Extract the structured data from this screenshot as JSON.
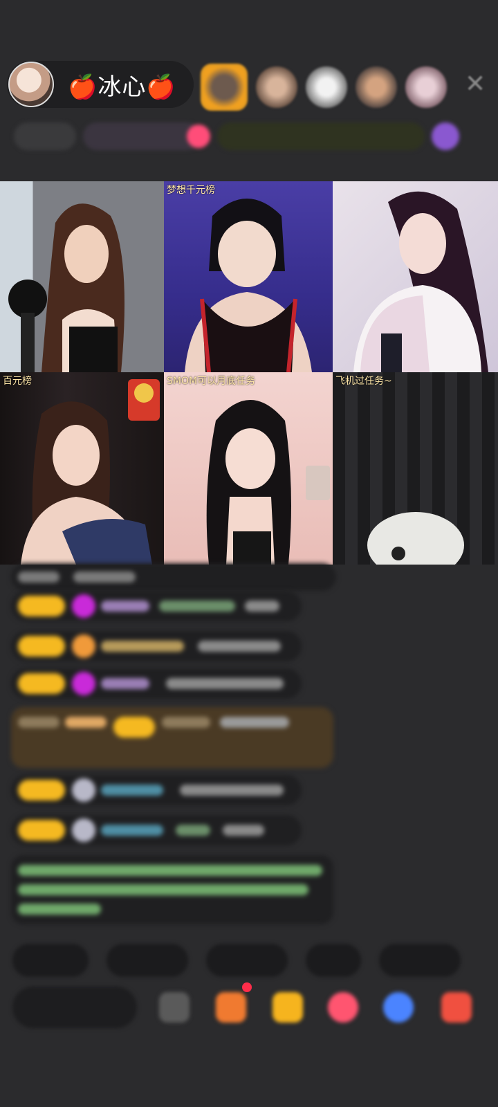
{
  "header": {
    "host_name": "冰心",
    "apple_glyph": "🍎",
    "close_glyph": "✕"
  },
  "colors": {
    "background": "#2b2b2d",
    "badge": "#f5b921",
    "bubble": "#1f1f21"
  },
  "streams": [
    {
      "overlay": ""
    },
    {
      "overlay": "梦想千元榜"
    },
    {
      "overlay": ""
    },
    {
      "overlay": "百元榜"
    },
    {
      "overlay": "SMOM可以月底任务"
    },
    {
      "overlay": "飞机过任务~"
    }
  ],
  "icons": [
    "avatar",
    "close-icon",
    "gift-icon",
    "box-icon",
    "gift-bag-icon",
    "smile-icon",
    "wave-icon",
    "grid-icon"
  ]
}
